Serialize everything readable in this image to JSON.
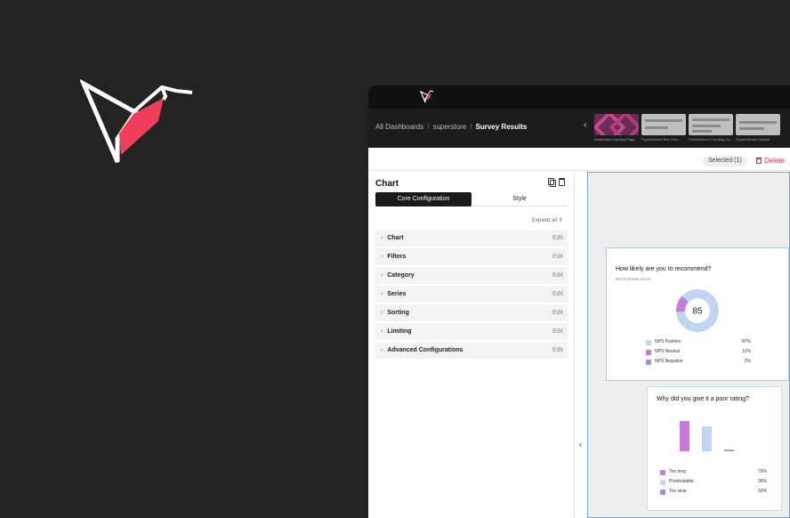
{
  "breadcrumb": {
    "items": [
      "All Dashboards",
      "superstore"
    ],
    "current": "Survey Results"
  },
  "thumbnails": [
    {
      "caption": "Dashboard Landing Page",
      "style": "pink"
    },
    {
      "caption": "PopWomen's Bar Conv...",
      "style": "gray"
    },
    {
      "caption": "PopWomen's Trending Co...",
      "style": "gray"
    },
    {
      "caption": "Social Media Content",
      "style": "gray"
    }
  ],
  "actions": {
    "selected_label": "Selected (1)",
    "delete_label": "Delete"
  },
  "panel": {
    "title": "Chart",
    "tabs": [
      "Core Configuration",
      "Style"
    ],
    "expand_all_label": "Expand all",
    "sections": [
      {
        "label": "Chart",
        "edit": "Edit"
      },
      {
        "label": "Filters",
        "edit": "Edit"
      },
      {
        "label": "Category",
        "edit": "Edit"
      },
      {
        "label": "Series",
        "edit": "Edit"
      },
      {
        "label": "Sorting",
        "edit": "Edit"
      },
      {
        "label": "Limiting",
        "edit": "Edit"
      },
      {
        "label": "Advanced Configurations",
        "edit": "Edit"
      }
    ]
  },
  "colors": {
    "brand_red": "#f03e5a",
    "accent_blue": "#6aa5de",
    "positive": "#c1d4f2",
    "neutral": "#c87ad9",
    "negative": "#a48ad8"
  },
  "chart_data": [
    {
      "type": "pie",
      "title": "How likely are you to recommend?",
      "subtitle": "Net Promoter Score",
      "center_label": "85",
      "categories": [
        "NPS Positive",
        "NPS Neutral",
        "NPS Negative"
      ],
      "values": [
        87,
        11,
        2
      ],
      "value_labels": [
        "87%",
        "11%",
        "2%"
      ],
      "colors": [
        "#c1d4f2",
        "#c87ad9",
        "#a48ad8"
      ]
    },
    {
      "type": "bar",
      "title": "Why did you give it a poor rating?",
      "categories": [
        "Too long",
        "Predicatable",
        "Too slow"
      ],
      "values": [
        75,
        36,
        50
      ],
      "value_labels": [
        "75%",
        "36%",
        "50%"
      ],
      "bar_heights": [
        1.0,
        0.82,
        0.05
      ],
      "colors": [
        "#c87ad9",
        "#c1d4f2",
        "#a48ad8"
      ]
    }
  ]
}
